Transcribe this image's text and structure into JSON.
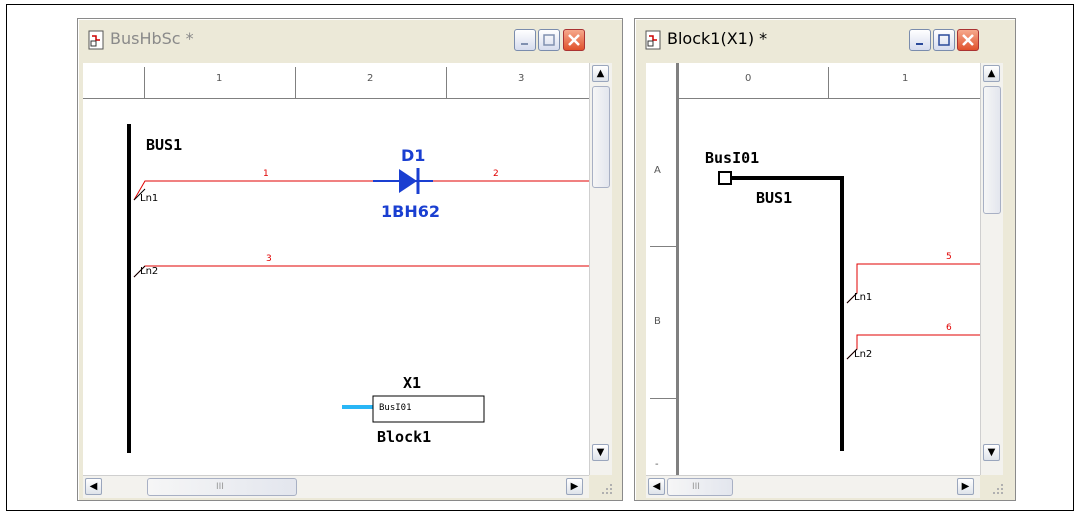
{
  "left_window": {
    "title": "BusHbSc *",
    "ruler": {
      "cols": [
        "1",
        "2",
        "3"
      ]
    },
    "bus": {
      "name": "BUS1",
      "entries": [
        "Ln1",
        "Ln2"
      ]
    },
    "nets": [
      "1",
      "2",
      "3"
    ],
    "diode": {
      "ref": "D1",
      "part": "1BH62"
    },
    "block": {
      "ref": "X1",
      "port": "BusI01",
      "name": "Block1"
    },
    "scroll": {
      "grip": "III"
    }
  },
  "right_window": {
    "title": "Block1(X1) *",
    "ruler": {
      "cols": [
        "0",
        "1"
      ],
      "rows": [
        "A",
        "B",
        "-"
      ]
    },
    "port": {
      "name": "BusI01"
    },
    "bus": {
      "name": "BUS1",
      "entries": [
        "Ln1",
        "Ln2"
      ]
    },
    "nets": [
      "5",
      "6"
    ],
    "scroll": {
      "grip": "III"
    }
  },
  "icons": {
    "title_icon": "schematic-page-icon",
    "minimize": "minimize-icon",
    "maximize": "maximize-icon",
    "close": "close-icon"
  }
}
